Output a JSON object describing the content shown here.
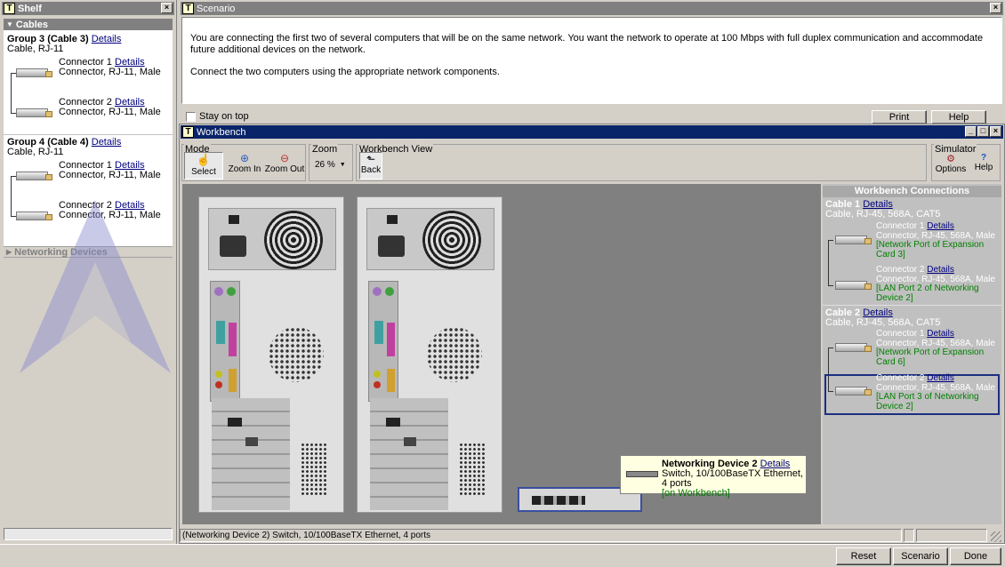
{
  "shelf": {
    "title": "Shelf",
    "close": "×",
    "cables_section": "Cables",
    "groups": [
      {
        "title": "Group 3 (Cable 3)",
        "details": "Details",
        "subtitle": "Cable, RJ-11",
        "connectors": [
          {
            "label": "Connector 1",
            "details": "Details",
            "desc": "Connector, RJ-11, Male"
          },
          {
            "label": "Connector 2",
            "details": "Details",
            "desc": "Connector, RJ-11, Male"
          }
        ]
      },
      {
        "title": "Group 4 (Cable 4)",
        "details": "Details",
        "subtitle": "Cable, RJ-11",
        "connectors": [
          {
            "label": "Connector 1",
            "details": "Details",
            "desc": "Connector, RJ-11, Male"
          },
          {
            "label": "Connector 2",
            "details": "Details",
            "desc": "Connector, RJ-11, Male"
          }
        ]
      }
    ],
    "networking_section": "Networking Devices"
  },
  "scenario": {
    "title": "Scenario",
    "close": "×",
    "text1": "You are connecting the first two of several computers that will be on the same network. You want the network to operate at 100 Mbps with full duplex communication and accommodate future additional devices on the network.",
    "text2": "Connect the two computers using the appropriate network components.",
    "stay_on_top": "Stay on top",
    "print": "Print",
    "help": "Help"
  },
  "workbench": {
    "title": "Workbench",
    "min": "_",
    "max": "□",
    "close": "×",
    "mode_label": "Mode",
    "select": "Select",
    "zoom_in": "Zoom In",
    "zoom_out": "Zoom Out",
    "zoom_label": "Zoom",
    "zoom_value": "26 %",
    "view_label": "Workbench View",
    "back": "Back",
    "simulator_label": "Simulator",
    "options": "Options",
    "help": "Help",
    "status": "(Networking Device 2) Switch, 10/100BaseTX Ethernet, 4 ports"
  },
  "tooltip": {
    "title": "Networking Device 2",
    "details": "Details",
    "desc": "Switch, 10/100BaseTX Ethernet, 4 ports",
    "state": "[on Workbench]"
  },
  "connections": {
    "header": "Workbench Connections",
    "cables": [
      {
        "title": "Cable 1",
        "details": "Details",
        "subtitle": "Cable, RJ-45, 568A, CAT5",
        "connectors": [
          {
            "label": "Connector 1",
            "details": "Details",
            "desc": "Connector, RJ-45, 568A, Male",
            "port": "[Network Port of Expansion Card 3]"
          },
          {
            "label": "Connector 2",
            "details": "Details",
            "desc": "Connector, RJ-45, 568A, Male",
            "port": "[LAN Port 2 of Networking Device 2]"
          }
        ]
      },
      {
        "title": "Cable 2",
        "details": "Details",
        "subtitle": "Cable, RJ-45, 568A, CAT5",
        "connectors": [
          {
            "label": "Connector 1",
            "details": "Details",
            "desc": "Connector, RJ-45, 568A, Male",
            "port": "[Network Port of Expansion Card 6]"
          },
          {
            "label": "Connector 2",
            "details": "Details",
            "desc": "Connector, RJ-45, 568A, Male",
            "port": "[LAN Port 3 of Networking Device 2]"
          }
        ]
      }
    ]
  },
  "bottom": {
    "reset": "Reset",
    "scenario": "Scenario",
    "done": "Done"
  }
}
